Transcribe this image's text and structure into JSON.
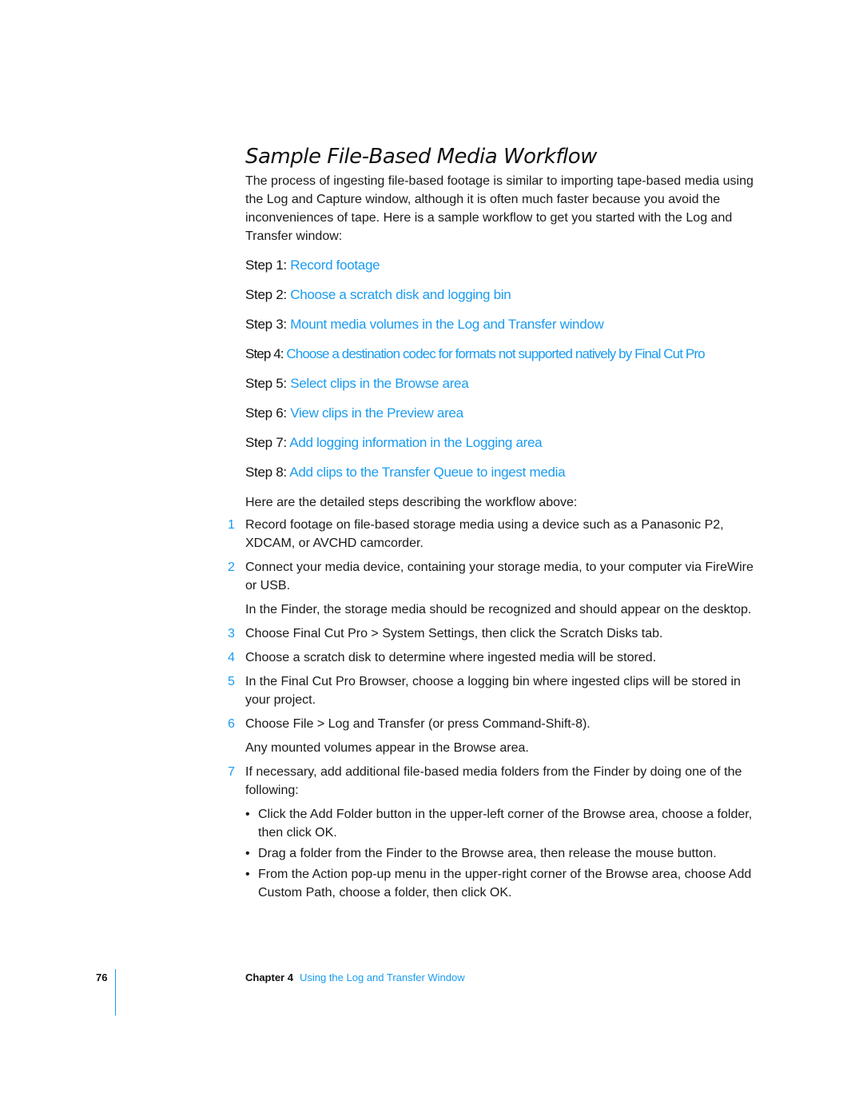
{
  "title": "Sample File-Based Media Workflow",
  "intro": "The process of ingesting file-based footage is similar to importing tape-based media using the Log and Capture window, although it is often much faster because you avoid the inconveniences of tape. Here is a sample workflow to get you started with the Log and Transfer window:",
  "steps": [
    {
      "label": "Step 1:",
      "link": "Record footage"
    },
    {
      "label": "Step 2:",
      "link": "Choose a scratch disk and logging bin"
    },
    {
      "label": "Step 3:",
      "link": "Mount media volumes in the Log and Transfer window"
    },
    {
      "label": "Step 4:",
      "link": "Choose a destination codec for formats not supported natively by Final Cut Pro"
    },
    {
      "label": "Step 5:",
      "link": "Select clips in the Browse area"
    },
    {
      "label": "Step 6:",
      "link": "View clips in the Preview area"
    },
    {
      "label": "Step 7:",
      "link": "Add logging information in the Logging area"
    },
    {
      "label": "Step 8:",
      "link": "Add clips to the Transfer Queue to ingest media"
    }
  ],
  "detail_intro": "Here are the detailed steps describing the workflow above:",
  "detailed_steps": [
    {
      "num": "1",
      "text": "Record footage on file-based storage media using a device such as a Panasonic P2, XDCAM, or AVCHD camcorder."
    },
    {
      "num": "2",
      "text": "Connect your media device, containing your storage media, to your computer via FireWire or USB.",
      "note": "In the Finder, the storage media should be recognized and should appear on the desktop."
    },
    {
      "num": "3",
      "text": "Choose Final Cut Pro > System Settings, then click the Scratch Disks tab."
    },
    {
      "num": "4",
      "text": "Choose a scratch disk to determine where ingested media will be stored."
    },
    {
      "num": "5",
      "text": "In the Final Cut Pro Browser, choose a logging bin where ingested clips will be stored in your project."
    },
    {
      "num": "6",
      "text": "Choose File > Log and Transfer (or press Command-Shift-8).",
      "note": "Any mounted volumes appear in the Browse area."
    },
    {
      "num": "7",
      "text": "If necessary, add additional file-based media folders from the Finder by doing one of the following:",
      "bullets": [
        "Click the Add Folder button in the upper-left corner of the Browse area, choose a folder, then click OK.",
        "Drag a folder from the Finder to the Browse area, then release the mouse button.",
        "From the Action pop-up menu in the upper-right corner of the Browse area, choose Add Custom Path, choose a folder, then click OK."
      ]
    }
  ],
  "bullet_glyph": "•",
  "footer": {
    "page_number": "76",
    "chapter_label": "Chapter 4",
    "chapter_title": "Using the Log and Transfer Window"
  },
  "colors": {
    "link": "#1a9bf0",
    "text": "#1a1a1a"
  }
}
